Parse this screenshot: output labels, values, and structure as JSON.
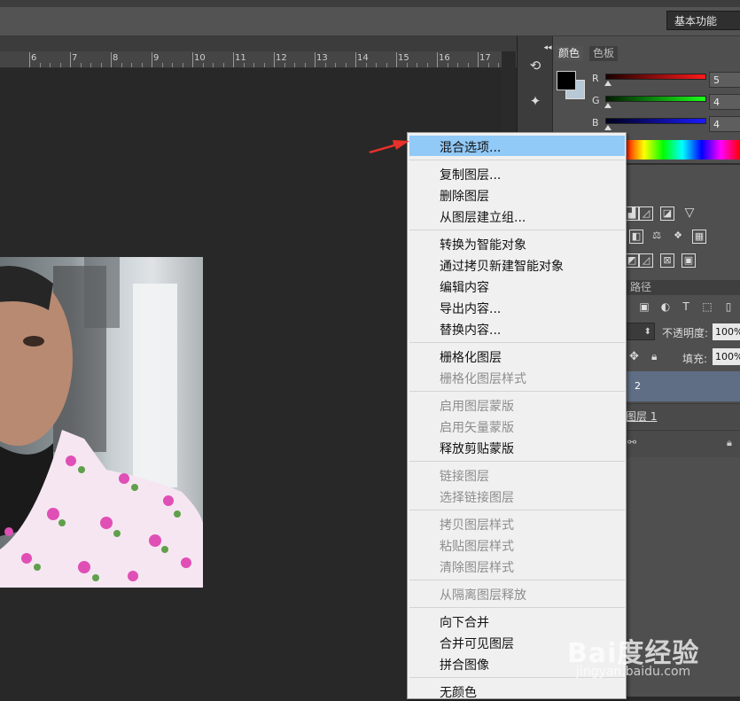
{
  "options_bar": {
    "workspace": "基本功能"
  },
  "ruler": {
    "numbers": [
      "6",
      "7",
      "8",
      "9",
      "10",
      "11",
      "12",
      "13",
      "14",
      "15",
      "16",
      "17"
    ]
  },
  "color_panel": {
    "tabs": [
      "颜色",
      "色板"
    ],
    "foreground": "#000000",
    "background": "#b7c8d6",
    "channels": [
      {
        "label": "R",
        "value": "5",
        "color": "#d11"
      },
      {
        "label": "G",
        "value": "4",
        "color": "#1c1"
      },
      {
        "label": "B",
        "value": "4",
        "color": "#11d"
      }
    ]
  },
  "layers_panel": {
    "paths_tab": "路径",
    "opacity_label": "不透明度:",
    "opacity_value": "100%",
    "fill_label": "填充:",
    "fill_value": "100%",
    "layers": [
      {
        "name": "2"
      },
      {
        "name": "图层 1"
      }
    ]
  },
  "context_menu": {
    "groups": [
      [
        {
          "label": "混合选项...",
          "enabled": true,
          "highlighted": true
        }
      ],
      [
        {
          "label": "复制图层...",
          "enabled": true
        },
        {
          "label": "删除图层",
          "enabled": true
        },
        {
          "label": "从图层建立组...",
          "enabled": true
        }
      ],
      [
        {
          "label": "转换为智能对象",
          "enabled": true
        },
        {
          "label": "通过拷贝新建智能对象",
          "enabled": true
        },
        {
          "label": "编辑内容",
          "enabled": true
        },
        {
          "label": "导出内容...",
          "enabled": true
        },
        {
          "label": "替换内容...",
          "enabled": true
        }
      ],
      [
        {
          "label": "栅格化图层",
          "enabled": true
        },
        {
          "label": "栅格化图层样式",
          "enabled": false
        }
      ],
      [
        {
          "label": "启用图层蒙版",
          "enabled": false
        },
        {
          "label": "启用矢量蒙版",
          "enabled": false
        },
        {
          "label": "释放剪贴蒙版",
          "enabled": true
        }
      ],
      [
        {
          "label": "链接图层",
          "enabled": false
        },
        {
          "label": "选择链接图层",
          "enabled": false
        }
      ],
      [
        {
          "label": "拷贝图层样式",
          "enabled": false
        },
        {
          "label": "粘贴图层样式",
          "enabled": false
        },
        {
          "label": "清除图层样式",
          "enabled": false
        }
      ],
      [
        {
          "label": "从隔离图层释放",
          "enabled": false
        }
      ],
      [
        {
          "label": "向下合并",
          "enabled": true
        },
        {
          "label": "合并可见图层",
          "enabled": true
        },
        {
          "label": "拼合图像",
          "enabled": true
        }
      ],
      [
        {
          "label": "无颜色",
          "enabled": true
        }
      ]
    ]
  },
  "watermark": {
    "brand": "Bai度经验",
    "url": "jingyan.baidu.com"
  }
}
